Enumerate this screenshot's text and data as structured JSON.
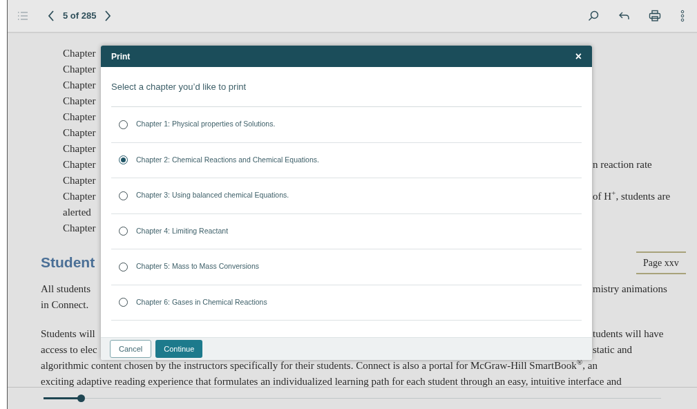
{
  "toolbar": {
    "page_indicator": "5 of 285"
  },
  "book": {
    "lines": [
      {
        "kind": "chapter",
        "left": "Chapter"
      },
      {
        "kind": "chapter",
        "left": "Chapter"
      },
      {
        "kind": "chapter",
        "left": "Chapter"
      },
      {
        "kind": "chapter",
        "left": "Chapter"
      },
      {
        "kind": "chapter",
        "left": "Chapter"
      },
      {
        "kind": "chapter",
        "left": "Chapter"
      },
      {
        "kind": "chapter",
        "left": "Chapter"
      },
      {
        "kind": "chapter",
        "left": "Chapter",
        "right": "n reaction rate"
      },
      {
        "kind": "chapter",
        "left": "Chapter"
      },
      {
        "kind": "chapter",
        "left": "Chapter",
        "right": "of H$^{+}$, students are"
      },
      {
        "kind": "chapter",
        "left": "alerted"
      },
      {
        "kind": "chapter",
        "left": "Chapter"
      },
      {
        "kind": "heading",
        "left": "Student",
        "right": "Page xxv"
      },
      {
        "kind": "body",
        "left": "All students",
        "right": "mistry animations"
      },
      {
        "kind": "body",
        "left": "in Connect."
      },
      {
        "kind": "body",
        "left": "Students will",
        "right": "tudents will have"
      },
      {
        "kind": "body",
        "left": "access to elec",
        "right": "static and"
      },
      {
        "kind": "full",
        "left": "algorithmic content chosen by the instructors specifically for their students. Connect is also a portal for McGraw-Hill SmartBook$^{®}$, an"
      },
      {
        "kind": "full",
        "left": "exciting adaptive reading experience that formulates an individualized learning path for each student through an easy, intuitive interface and"
      }
    ]
  },
  "progress": {
    "level": 0.06
  },
  "dialog": {
    "title": "Print",
    "close": "×",
    "prompt": "Select a chapter you’d like to print",
    "options": [
      {
        "label": "Chapter 1: Physical properties of Solutions.",
        "selected": false
      },
      {
        "label": "Chapter 2: Chemical Reactions and Chemical Equations.",
        "selected": true
      },
      {
        "label": "Chapter 3: Using balanced chemical Equations.",
        "selected": false
      },
      {
        "label": "Chapter 4: Limiting Reactant",
        "selected": false
      },
      {
        "label": "Chapter 5: Mass to Mass Conversions",
        "selected": false
      },
      {
        "label": "Chapter 6: Gases in Chemical Reactions",
        "selected": false
      }
    ],
    "buttons": [
      "Cancel",
      "Continue"
    ]
  }
}
